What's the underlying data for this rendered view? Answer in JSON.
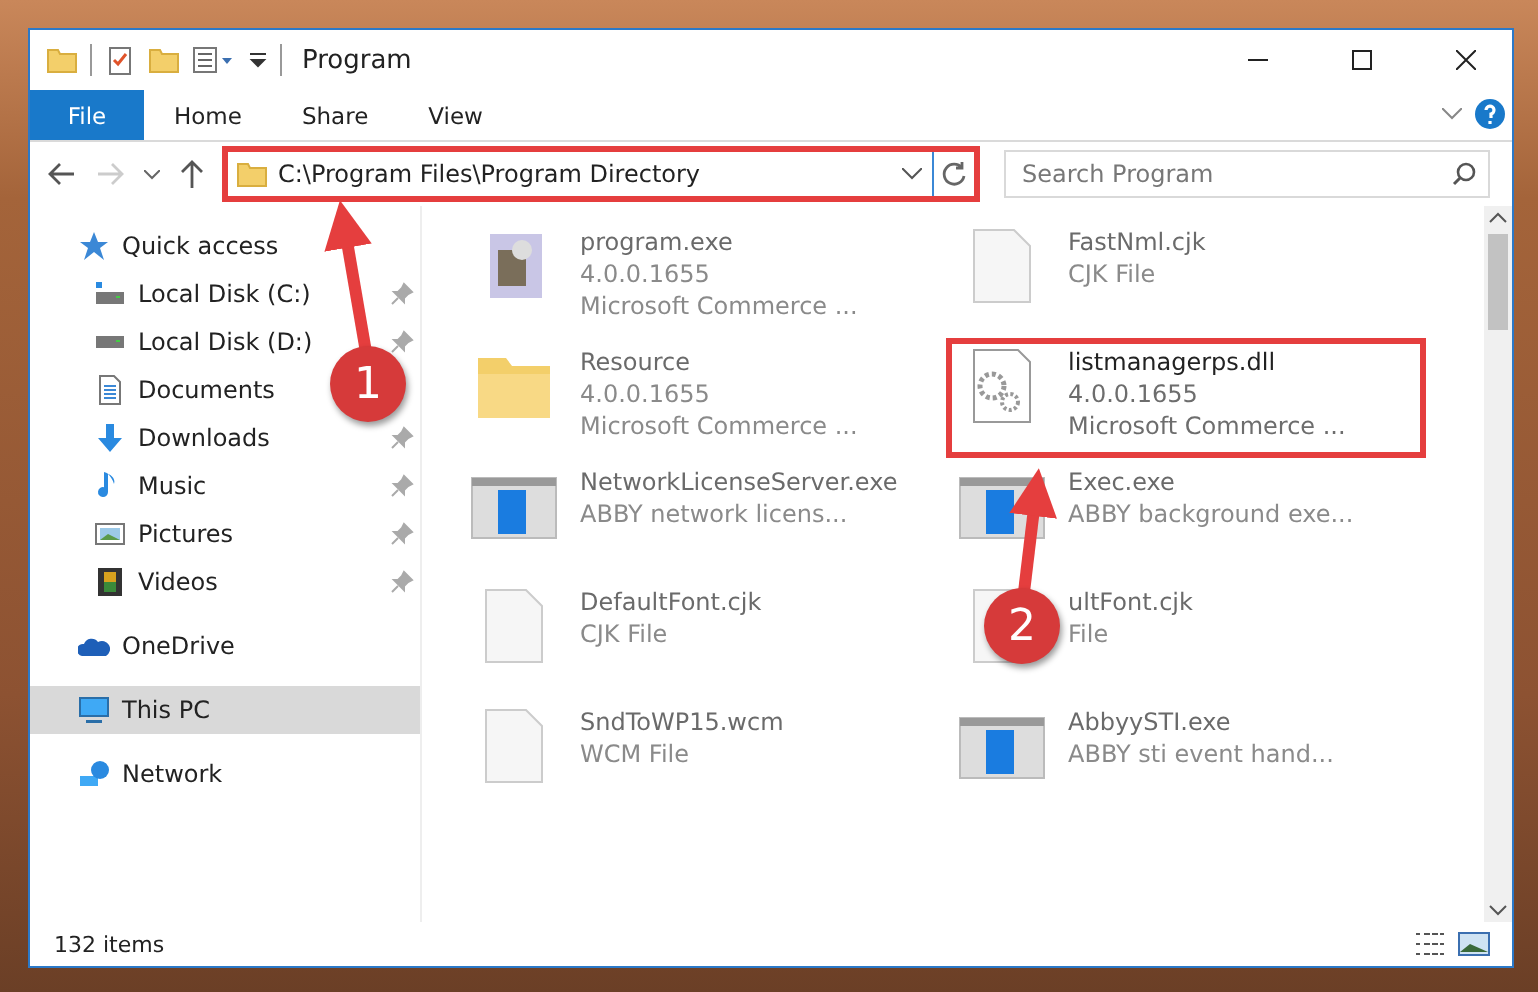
{
  "window": {
    "title": "Program"
  },
  "ribbon_tabs": [
    {
      "label": "File",
      "selected": true
    },
    {
      "label": "Home",
      "selected": false
    },
    {
      "label": "Share",
      "selected": false
    },
    {
      "label": "View",
      "selected": false
    }
  ],
  "address": {
    "path": "C:\\Program Files\\Program Directory",
    "highlighted": true
  },
  "search": {
    "placeholder": "Search Program"
  },
  "sidebar": {
    "items": [
      {
        "label": "Quick access",
        "kind": "star",
        "selected": false,
        "children": [
          {
            "label": "Local Disk (C:)",
            "kind": "drive-c",
            "pinned": true,
            "selected": false
          },
          {
            "label": "Local Disk (D:)",
            "kind": "drive",
            "pinned": true,
            "selected": false
          },
          {
            "label": "Documents",
            "kind": "documents",
            "pinned": false,
            "selected": false
          },
          {
            "label": "Downloads",
            "kind": "downloads",
            "pinned": true,
            "selected": false
          },
          {
            "label": "Music",
            "kind": "music",
            "pinned": true,
            "selected": false
          },
          {
            "label": "Pictures",
            "kind": "pictures",
            "pinned": true,
            "selected": false
          },
          {
            "label": "Videos",
            "kind": "videos",
            "pinned": true,
            "selected": false
          }
        ]
      },
      {
        "label": "OneDrive",
        "kind": "cloud",
        "selected": false
      },
      {
        "label": "This PC",
        "kind": "pc",
        "selected": true
      },
      {
        "label": "Network",
        "kind": "network",
        "selected": false
      }
    ]
  },
  "files": [
    {
      "name": "program.exe",
      "lines": [
        "4.0.0.1655",
        "Microsoft Commerce ..."
      ],
      "kind": "installer",
      "blurred": true,
      "highlighted": false
    },
    {
      "name": "FastNml.cjk",
      "lines": [
        "CJK File"
      ],
      "kind": "doc",
      "blurred": true,
      "highlighted": false
    },
    {
      "name": "Resource",
      "lines": [
        "4.0.0.1655",
        "Microsoft Commerce ..."
      ],
      "kind": "folder",
      "blurred": true,
      "highlighted": false
    },
    {
      "name": "listmanagerps.dll",
      "lines": [
        "4.0.0.1655",
        "Microsoft Commerce ..."
      ],
      "kind": "dll",
      "blurred": false,
      "highlighted": true
    },
    {
      "name": "NetworkLicenseServer.exe",
      "lines": [
        "ABBY network licens..."
      ],
      "kind": "app",
      "blurred": true,
      "highlighted": false
    },
    {
      "name": "Exec.exe",
      "lines": [
        "ABBY background exe..."
      ],
      "kind": "app",
      "blurred": true,
      "highlighted": false
    },
    {
      "name": "DefaultFont.cjk",
      "lines": [
        "CJK File"
      ],
      "kind": "doc",
      "blurred": true,
      "highlighted": false
    },
    {
      "name": "ultFont.cjk",
      "lines": [
        "File"
      ],
      "kind": "doc",
      "blurred": true,
      "highlighted": false
    },
    {
      "name": "SndToWP15.wcm",
      "lines": [
        "WCM File"
      ],
      "kind": "doc",
      "blurred": true,
      "highlighted": false
    },
    {
      "name": "AbbyySTI.exe",
      "lines": [
        "ABBY sti event hand..."
      ],
      "kind": "app",
      "blurred": true,
      "highlighted": false
    }
  ],
  "status_bar": {
    "count": "132 items"
  },
  "annotations": [
    {
      "label": "1"
    },
    {
      "label": "2"
    }
  ]
}
